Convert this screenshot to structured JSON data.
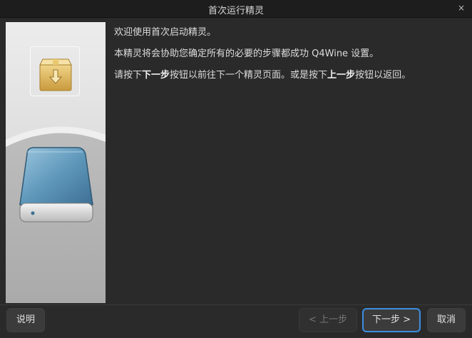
{
  "window": {
    "title": "首次运行精灵",
    "close_glyph": "×"
  },
  "side_panel": {
    "top_icon": "package-install-icon",
    "bottom_icon": "hard-drive-icon"
  },
  "content": {
    "line1": "欢迎使用首次启动精灵。",
    "line2": "本精灵将会协助您确定所有的必要的步骤都成功 Q4Wine 设置。",
    "line3": {
      "part1": "请按下",
      "bold1": "下一步",
      "part2": "按钮以前往下一个精灵页面。或是按下",
      "bold2": "上一步",
      "part3": "按钮以返回。"
    }
  },
  "buttons": {
    "help": "说明",
    "back": "< 上一步",
    "next": "下一步 >",
    "cancel": "取消"
  },
  "colors": {
    "accent": "#3d8ee0",
    "window_bg": "#2a2a2a"
  }
}
